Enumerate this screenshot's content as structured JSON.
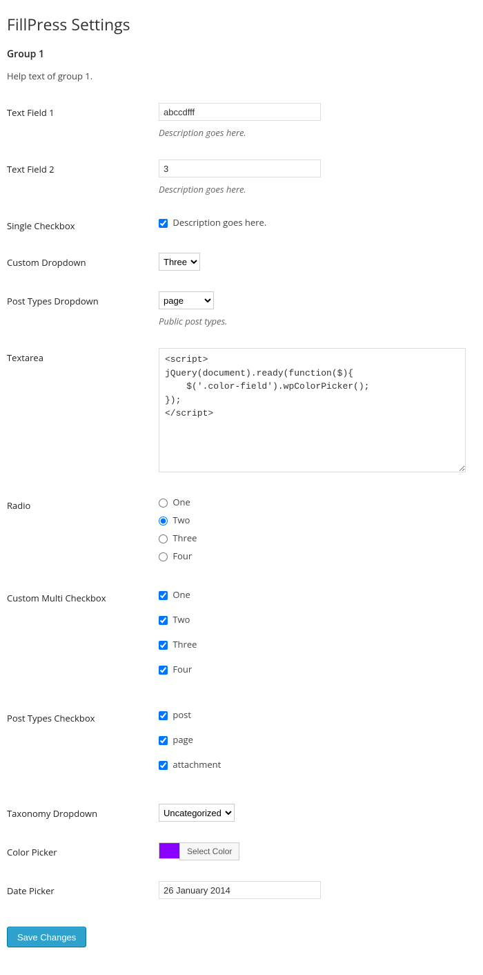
{
  "page": {
    "title": "FillPress Settings",
    "group_heading": "Group 1",
    "group_help": "Help text of group 1."
  },
  "fields": {
    "text1": {
      "label": "Text Field 1",
      "value": "abccdfff",
      "desc": "Description goes here."
    },
    "text2": {
      "label": "Text Field 2",
      "value": "3",
      "desc": "Description goes here."
    },
    "single_cb": {
      "label": "Single Checkbox",
      "option_label": "Description goes here.",
      "checked": true
    },
    "custom_dd": {
      "label": "Custom Dropdown",
      "value": "Three"
    },
    "posttypes_dd": {
      "label": "Post Types Dropdown",
      "value": "page",
      "desc": "Public post types."
    },
    "textarea": {
      "label": "Textarea",
      "value": "<script>\njQuery(document).ready(function($){\n    $('.color-field').wpColorPicker();\n});\n</script>"
    },
    "radio": {
      "label": "Radio",
      "options": [
        "One",
        "Two",
        "Three",
        "Four"
      ],
      "selected": "Two"
    },
    "multi_cb": {
      "label": "Custom Multi Checkbox",
      "options": [
        "One",
        "Two",
        "Three",
        "Four"
      ],
      "checked": [
        "One",
        "Two",
        "Three",
        "Four"
      ]
    },
    "posttypes_cb": {
      "label": "Post Types Checkbox",
      "options": [
        "post",
        "page",
        "attachment"
      ],
      "checked": [
        "post",
        "page",
        "attachment"
      ]
    },
    "taxonomy_dd": {
      "label": "Taxonomy Dropdown",
      "value": "Uncategorized"
    },
    "color": {
      "label": "Color Picker",
      "value": "#8a00ff",
      "button": "Select Color"
    },
    "date": {
      "label": "Date Picker",
      "value": "26 January 2014"
    }
  },
  "submit": {
    "label": "Save Changes"
  }
}
